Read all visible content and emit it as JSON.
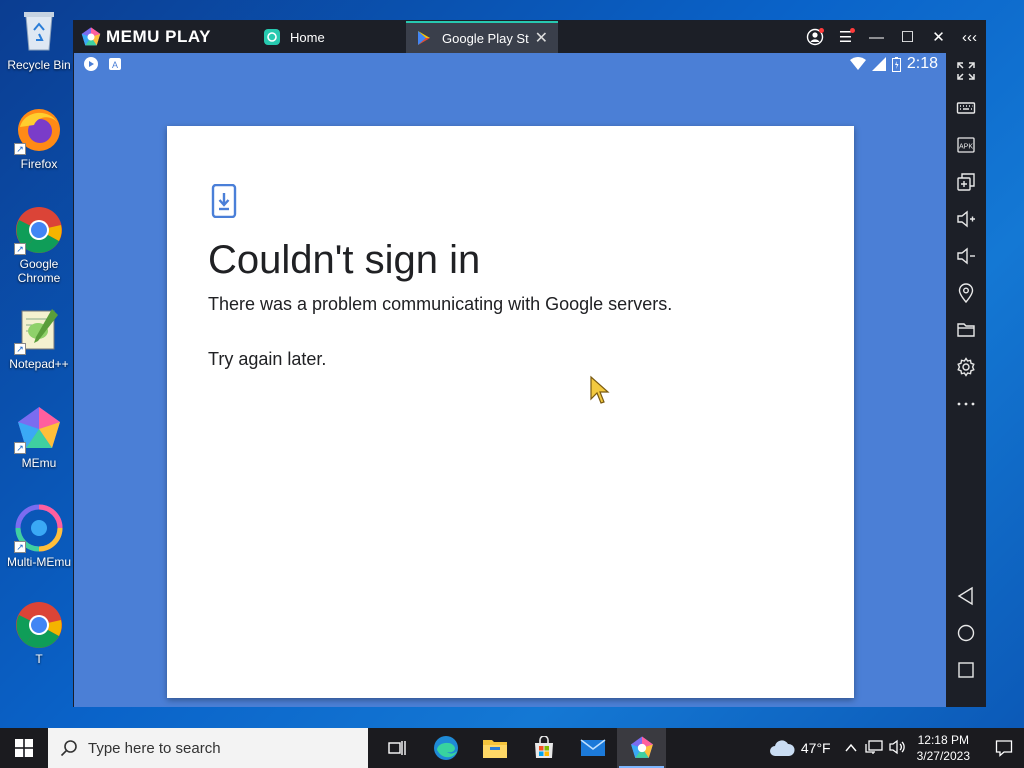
{
  "desktop": {
    "icons": [
      {
        "label": "Recycle Bin",
        "icon": "recycle-bin-icon"
      },
      {
        "label": "Firefox",
        "icon": "firefox-icon"
      },
      {
        "label": "Google Chrome",
        "icon": "chrome-icon"
      },
      {
        "label": "Notepad++",
        "icon": "notepad-plus-plus-icon"
      },
      {
        "label": "MEmu",
        "icon": "memu-icon"
      },
      {
        "label": "Multi-MEmu",
        "icon": "multi-memu-icon"
      },
      {
        "label": "T",
        "icon": "chrome-icon"
      }
    ]
  },
  "emulator": {
    "brand": "MEMU PLAY",
    "tabs": [
      {
        "label": "Home",
        "icon": "home-app-icon"
      },
      {
        "label": "Google Play Store",
        "icon": "play-store-icon"
      }
    ],
    "android": {
      "time": "2:18",
      "dialog": {
        "title": "Couldn't sign in",
        "message": "There was a problem communicating with Google servers.",
        "retry": "Try again later."
      }
    },
    "toolbar": [
      "fullscreen-icon",
      "keyboard-icon",
      "apk-icon",
      "multi-window-icon",
      "volume-up-icon",
      "volume-down-icon",
      "location-icon",
      "folder-icon",
      "settings-icon",
      "more-icon",
      "back-icon",
      "home-icon",
      "recents-icon"
    ]
  },
  "taskbar": {
    "search_placeholder": "Type here to search",
    "weather": "47°F",
    "time": "12:18 PM",
    "date": "3/27/2023"
  },
  "colors": {
    "android_bg": "#4b7fd6",
    "titlebar": "#1c1f27",
    "tab_accent": "#27c9b0",
    "dialog_icon": "#4a7fd8"
  }
}
